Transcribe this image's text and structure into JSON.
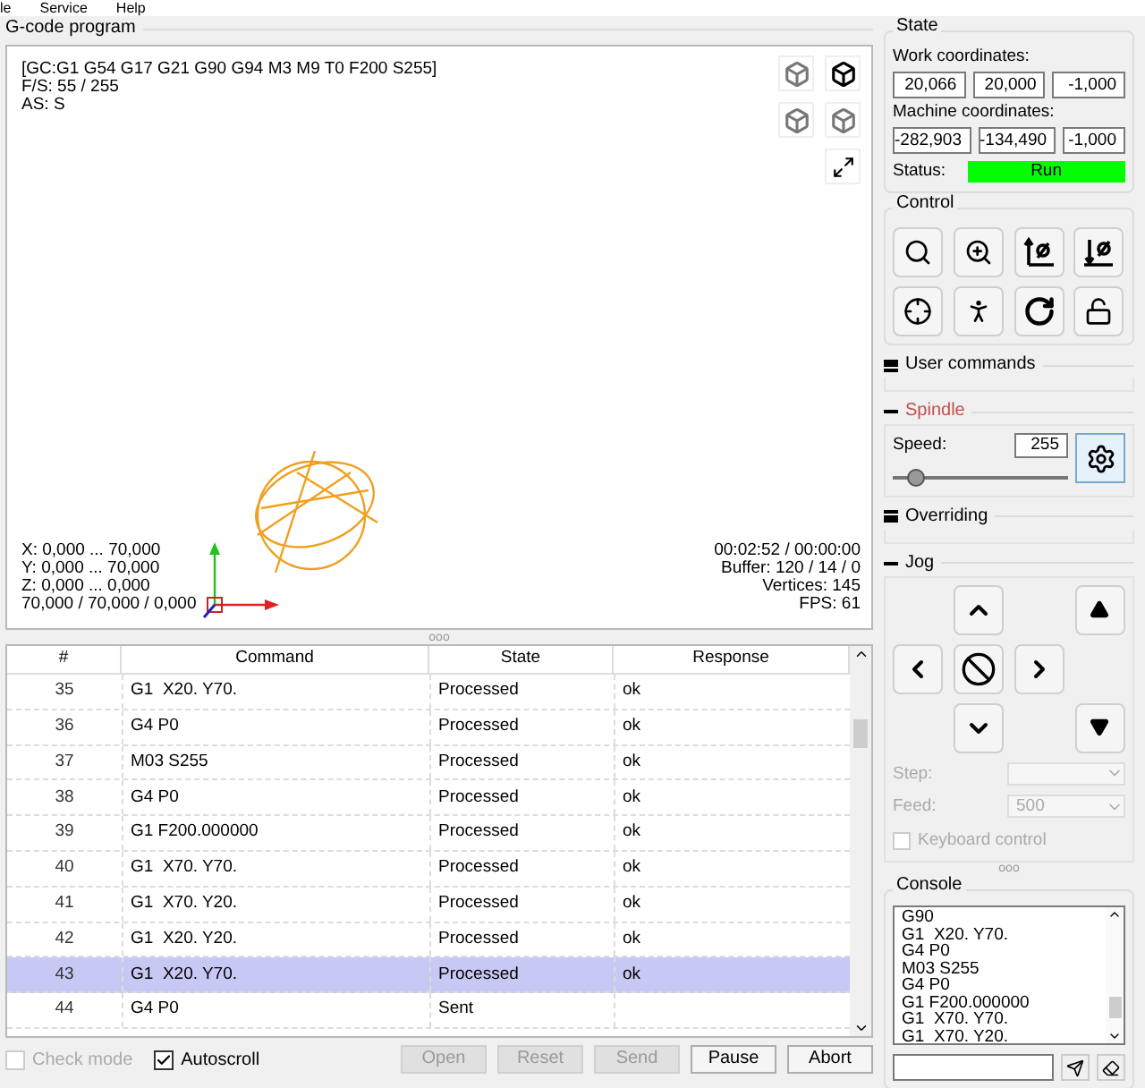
{
  "menu": [
    "le",
    "Service",
    "Help"
  ],
  "gcode_panel": {
    "title": "G-code program",
    "status_lines": [
      "[GC:G1 G54 G17 G21 G90 G94 M3 M9 T0 F200 S255]",
      "F/S: 55 / 255",
      "AS: S"
    ],
    "range_lines": [
      "X: 0,000 ... 70,000",
      "Y: 0,000 ... 70,000",
      "Z: 0,000 ... 0,000",
      "70,000 / 70,000 / 0,000"
    ],
    "info_lines": [
      "00:02:52 / 00:00:00",
      "Buffer: 120 / 14 / 0",
      "Vertices: 145",
      "FPS: 61"
    ]
  },
  "splitter": "ooo",
  "console_splitter": "ooo",
  "table": {
    "columns": [
      "#",
      "Command",
      "State",
      "Response"
    ],
    "rows": [
      {
        "number": "35",
        "command": "G1  X20. Y70.",
        "state": "Processed",
        "response": "ok",
        "selected": false
      },
      {
        "number": "36",
        "command": "G4 P0",
        "state": "Processed",
        "response": "ok",
        "selected": false
      },
      {
        "number": "37",
        "command": "M03 S255",
        "state": "Processed",
        "response": "ok",
        "selected": false
      },
      {
        "number": "38",
        "command": "G4 P0",
        "state": "Processed",
        "response": "ok",
        "selected": false
      },
      {
        "number": "39",
        "command": "G1 F200.000000",
        "state": "Processed",
        "response": "ok",
        "selected": false
      },
      {
        "number": "40",
        "command": "G1  X70. Y70.",
        "state": "Processed",
        "response": "ok",
        "selected": false
      },
      {
        "number": "41",
        "command": "G1  X70. Y20.",
        "state": "Processed",
        "response": "ok",
        "selected": false
      },
      {
        "number": "42",
        "command": "G1  X20. Y20.",
        "state": "Processed",
        "response": "ok",
        "selected": false
      },
      {
        "number": "43",
        "command": "G1  X20. Y70.",
        "state": "Processed",
        "response": "ok",
        "selected": true
      },
      {
        "number": "44",
        "command": "G4 P0",
        "state": "Sent",
        "response": "",
        "selected": false
      }
    ]
  },
  "options": [
    {
      "label": "Check mode",
      "checked": false,
      "disabled": true
    },
    {
      "label": "Autoscroll",
      "checked": true,
      "disabled": false
    }
  ],
  "buttons": [
    {
      "label": "Open",
      "disabled": true
    },
    {
      "label": "Reset",
      "disabled": true
    },
    {
      "label": "Send",
      "disabled": true
    },
    {
      "label": "Pause",
      "disabled": false
    },
    {
      "label": "Abort",
      "disabled": false
    }
  ],
  "state": {
    "title": "State",
    "work_label": "Work coordinates:",
    "work": [
      "20,066",
      "20,000",
      "-1,000"
    ],
    "machine_label": "Machine coordinates:",
    "machine": [
      "-282,903",
      "-134,490",
      "-1,000"
    ],
    "status_label": "Status:",
    "status": "Run"
  },
  "control": {
    "title": "Control"
  },
  "user_commands": {
    "title": "User commands",
    "expanded": false
  },
  "spindle": {
    "title": "Spindle",
    "expanded": true,
    "speed_label": "Speed:",
    "speed": "255",
    "level": 0.13
  },
  "overriding": {
    "title": "Overriding",
    "expanded": false
  },
  "jog": {
    "title": "Jog",
    "expanded": true,
    "step_label": "Step:",
    "feed_label": "Feed:",
    "feed": "500",
    "keyboard_label": "Keyboard control",
    "keyboard_checked": false
  },
  "console": {
    "title": "Console",
    "lines": [
      "G90",
      "G1  X20. Y70.",
      "G4 P0",
      "M03 S255",
      "G4 P0",
      "G1 F200.000000",
      "G1  X70. Y70.",
      "G1  X70. Y20."
    ]
  }
}
